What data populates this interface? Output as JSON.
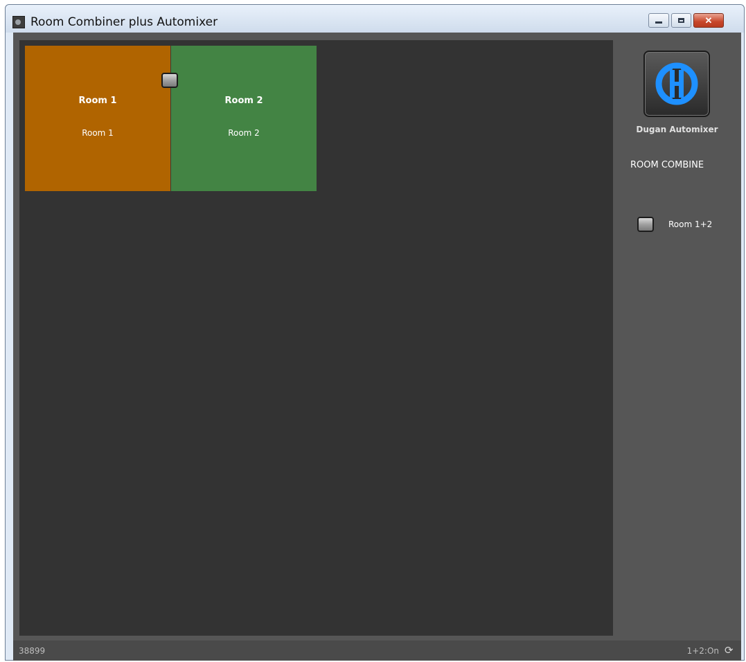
{
  "window": {
    "title": "Room Combiner plus Automixer",
    "app_icon": "app-icon"
  },
  "canvas": {
    "rooms": [
      {
        "name": "Room 1",
        "sub": "Room 1",
        "color": "#b06400"
      },
      {
        "name": "Room 2",
        "sub": "Room 2",
        "color": "#438444"
      }
    ],
    "combine_button_state": "off"
  },
  "side": {
    "logo_label": "Dugan Automixer",
    "section_label": "ROOM COMBINE",
    "combine_label": "Room 1+2"
  },
  "status": {
    "left": "38899",
    "right": "1+2:On",
    "refresh_icon": "refresh-icon"
  },
  "colors": {
    "accent": "#1e90ff",
    "room1": "#b06400",
    "room2": "#438444",
    "canvas": "#333333",
    "panel": "#565656"
  }
}
